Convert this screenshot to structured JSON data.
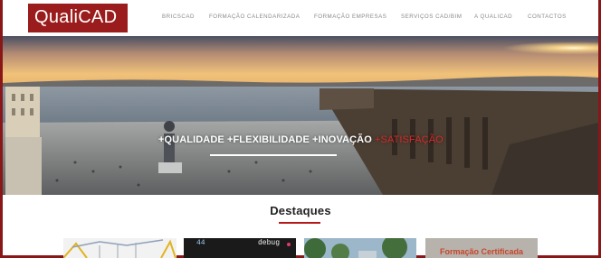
{
  "brand": {
    "logo_text": "QualiCAD",
    "logo_color": "#9b1c1c"
  },
  "nav": {
    "items": [
      {
        "label": "BRICSCAD"
      },
      {
        "label": "FORMAÇÃO CALENDARIZADA"
      },
      {
        "label": "FORMAÇÃO EMPRESAS"
      },
      {
        "label": "SERVIÇOS CAD/BIM"
      },
      {
        "label": "A QUALICAD"
      },
      {
        "label": "CONTACTOS"
      }
    ]
  },
  "hero": {
    "tagline_main": "+QUALIDADE +FLEXIBILIDADE +INOVAÇÃO",
    "tagline_accent": "+SATISFAÇÃO",
    "accent_color": "#d62a2a"
  },
  "highlights": {
    "title": "Destaques",
    "cards": [
      {
        "name": "construction"
      },
      {
        "name": "code",
        "code_left": "44",
        "code_right": "debug"
      },
      {
        "name": "trees"
      },
      {
        "name": "certification",
        "label": "Formação Certificada"
      }
    ]
  },
  "colors": {
    "frame": "#8a1717",
    "brand": "#9b1c1c"
  }
}
